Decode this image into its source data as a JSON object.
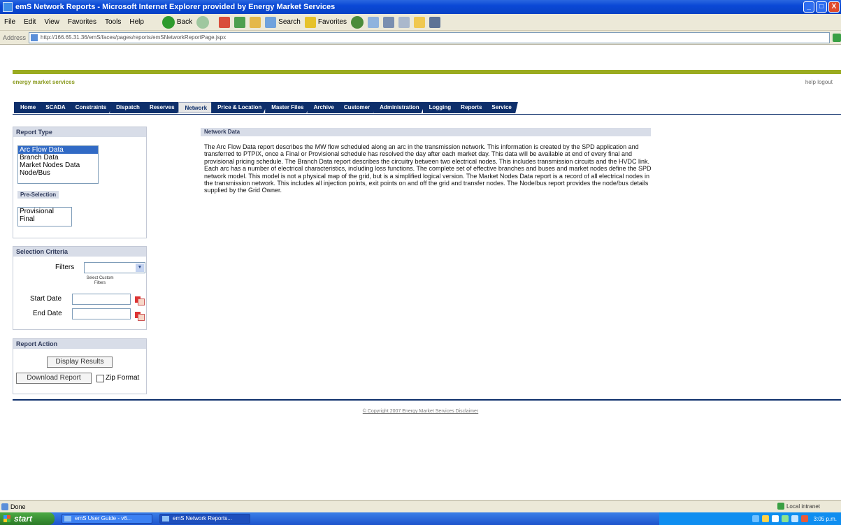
{
  "window": {
    "title": "emS Network Reports - Microsoft Internet Explorer provided by Energy Market Services",
    "minimize": "_",
    "maximize": "□",
    "close": "X"
  },
  "menubar": {
    "items": [
      "File",
      "Edit",
      "View",
      "Favorites",
      "Tools",
      "Help"
    ],
    "back_label": "Back",
    "search_label": "Search",
    "favorites_label": "Favorites"
  },
  "address": {
    "label": "Address",
    "url": "http://166.65.31.36/emS/faces/pages/reports/emSNetworkReportPage.jspx"
  },
  "site": {
    "brand": "energy market services",
    "help_links": "help logout",
    "tabs": [
      {
        "label": "Home",
        "active": false
      },
      {
        "label": "SCADA",
        "active": false
      },
      {
        "label": "Constraints",
        "active": false
      },
      {
        "label": "Dispatch",
        "active": false
      },
      {
        "label": "Reserves",
        "active": false
      },
      {
        "label": "Network",
        "active": true
      },
      {
        "label": "Price & Location",
        "active": false
      },
      {
        "label": "Master Files",
        "active": false
      },
      {
        "label": "Archive",
        "active": false
      },
      {
        "label": "Customer",
        "active": false
      },
      {
        "label": "Administration",
        "active": false
      },
      {
        "label": "Logging",
        "active": false
      },
      {
        "label": "Reports",
        "active": false
      },
      {
        "label": "Service",
        "active": false
      }
    ]
  },
  "report_type": {
    "title": "Report Type",
    "options": [
      "Arc Flow Data",
      "Branch Data",
      "Market Nodes Data",
      "Node/Bus"
    ],
    "selected": "Arc Flow Data",
    "pre_selection_title": "Pre-Selection",
    "pre_selection_options": [
      "Provisional",
      "Final"
    ]
  },
  "selection_criteria": {
    "title": "Selection Criteria",
    "filters_label": "Filters",
    "filters_value": "",
    "filters_hint": "Select Custom Filters",
    "start_date_label": "Start Date",
    "end_date_label": "End Date",
    "start_date_value": "",
    "end_date_value": ""
  },
  "report_action": {
    "title": "Report Action",
    "display_button": "Display Results",
    "download_button": "Download Report",
    "zip_label": "Zip Format",
    "zip_checked": false
  },
  "main": {
    "heading": "Network Data",
    "body": "The Arc Flow Data report describes the MW flow scheduled along an arc in the transmission network. This information is created by the SPD application and transferred to PTPIX, once a Final or Provisional schedule has resolved the day after each market day. This data will be available at end of every final and provisional pricing schedule. The Branch Data report describes the circuitry between two electrical nodes. This includes transmission circuits and the HVDC link. Each arc has a number of electrical characteristics, including loss functions. The complete set of effective branches and buses and market nodes define the SPD network model. This model is not a physical map of the grid, but is a simplified logical version. The Market Nodes Data report is a record of all electrical nodes in the transmission network. This includes all injection points, exit points on and off the grid and transfer nodes. The Node/bus report provides the node/bus details supplied by the Grid Owner."
  },
  "footer": {
    "copyright": "© Copyright 2007 Energy Market Services Disclaimer"
  },
  "statusbar": {
    "status": "Done",
    "zone": "Local intranet"
  },
  "taskbar": {
    "start": "start",
    "tasks": [
      "emS User Guide - v6...",
      "emS Network Reports..."
    ],
    "clock": "3:05 p.m."
  }
}
